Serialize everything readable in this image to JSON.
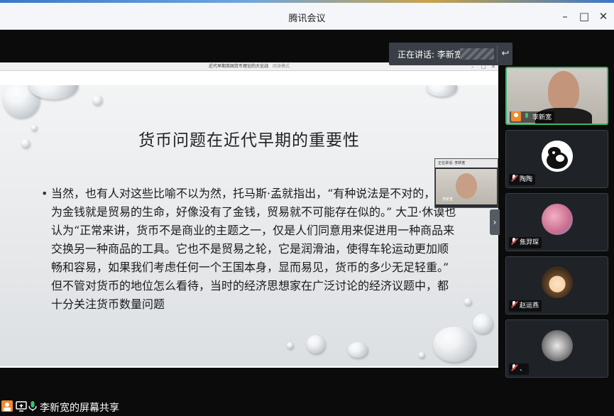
{
  "app": {
    "title": "腾讯会议"
  },
  "speaking": {
    "prefix": "正在讲话: 李新宽"
  },
  "shared_window": {
    "title": "近代早期英国货币理论的大论战",
    "mode_text": "阅读模式",
    "slide": {
      "title": "货币问题在近代早期的重要性",
      "bullet": "当然，也有人对这些比喻不以为然，托马斯·孟就指出，“有种说法是不对的，以为金钱就是贸易的生命，好像没有了金钱，贸易就不可能存在似的。” 大卫·休谟也认为“正常来讲，货币不是商业的主题之一，仅是人们同意用来促进用一种商品来交换另一种商品的工具。它也不是贸易之轮，它是润滑油，使得车轮运动更加顺畅和容易，如果我们考虑任何一个王国本身，显而易见，货币的多少无足轻重。” 但不管对货币的地位怎么看待，当时的经济思想家在广泛讨论的经济议题中，都十分关注货币数量问题"
    },
    "pip": {
      "header": "正在讲话: 李新宽",
      "name": "李新宽"
    }
  },
  "participants": [
    {
      "name": "李新宽",
      "mic": "on",
      "host": true,
      "active": true
    },
    {
      "name": "陶陶",
      "mic": "off",
      "host": false,
      "active": false
    },
    {
      "name": "焦羿琛",
      "mic": "off",
      "host": false,
      "active": false
    },
    {
      "name": "赵运燕",
      "mic": "off",
      "host": false,
      "active": false
    },
    {
      "name": "、",
      "mic": "off",
      "host": false,
      "active": false
    }
  ],
  "bottom": {
    "share_label": "李新宽的屏幕共享"
  },
  "colors": {
    "accent_green": "#3bb56b",
    "host_orange": "#f08a32",
    "mic_off_red": "#e34d4d"
  }
}
